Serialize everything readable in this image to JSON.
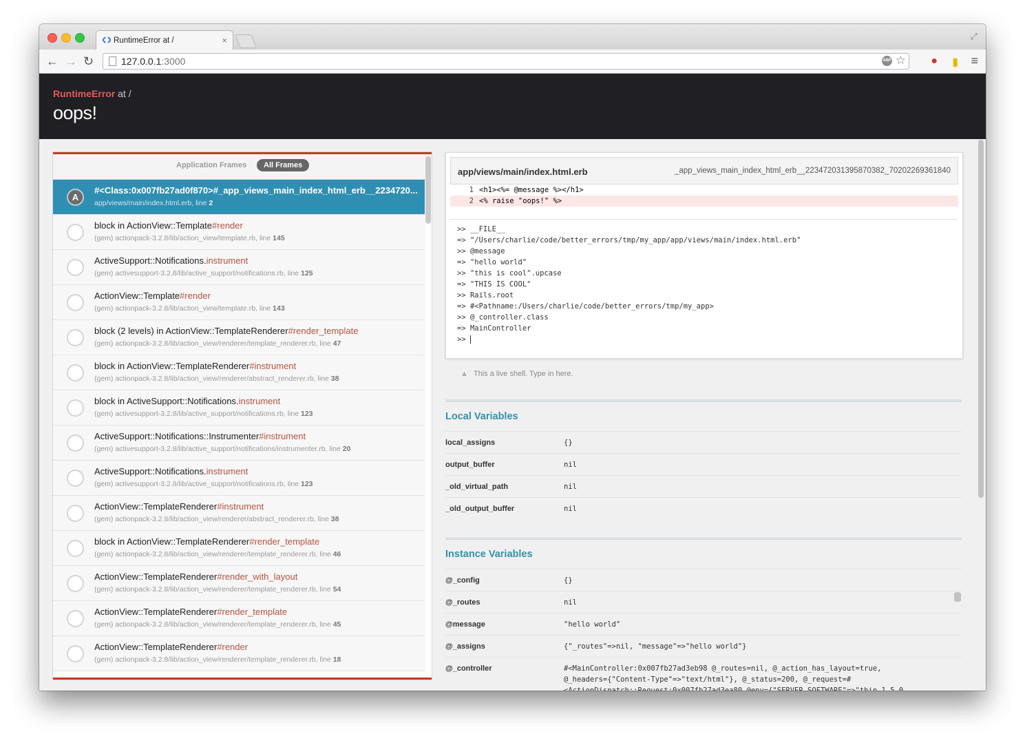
{
  "browser": {
    "tab_title": "RuntimeError at /",
    "tab_close": "×",
    "url_host": "127.0.0.1",
    "url_port": ":3000",
    "abp_label": "ABP"
  },
  "error": {
    "class": "RuntimeError",
    "at": " at /",
    "message": "oops!"
  },
  "frames_tabs": {
    "application": "Application Frames",
    "all": "All Frames"
  },
  "frames": [
    {
      "circle": "A",
      "name": "#<Class:0x007fb27ad0f870>#_app_views_main_index_html_erb__2234720...",
      "method": "",
      "loc": "app/views/main/index.html.erb, line ",
      "line": "2",
      "selected": true
    },
    {
      "circle": "",
      "name": "block in ActionView::Template",
      "method": "#render",
      "loc": "(gem) actionpack-3.2.8/lib/action_view/template.rb, line ",
      "line": "145"
    },
    {
      "circle": "",
      "name": "ActiveSupport::Notifications.",
      "method": "instrument",
      "loc": "(gem) activesupport-3.2.8/lib/active_support/notifications.rb, line ",
      "line": "125"
    },
    {
      "circle": "",
      "name": "ActionView::Template",
      "method": "#render",
      "loc": "(gem) actionpack-3.2.8/lib/action_view/template.rb, line ",
      "line": "143"
    },
    {
      "circle": "",
      "name": "block (2 levels) in ActionView::TemplateRenderer",
      "method": "#render_template",
      "loc": "(gem) actionpack-3.2.8/lib/action_view/renderer/template_renderer.rb, line ",
      "line": "47"
    },
    {
      "circle": "",
      "name": "block in ActionView::TemplateRenderer",
      "method": "#instrument",
      "loc": "(gem) actionpack-3.2.8/lib/action_view/renderer/abstract_renderer.rb, line ",
      "line": "38"
    },
    {
      "circle": "",
      "name": "block in ActiveSupport::Notifications.",
      "method": "instrument",
      "loc": "(gem) activesupport-3.2.8/lib/active_support/notifications.rb, line ",
      "line": "123"
    },
    {
      "circle": "",
      "name": "ActiveSupport::Notifications::Instrumenter",
      "method": "#instrument",
      "loc": "(gem) activesupport-3.2.8/lib/active_support/notifications/instrumenter.rb, line ",
      "line": "20"
    },
    {
      "circle": "",
      "name": "ActiveSupport::Notifications.",
      "method": "instrument",
      "loc": "(gem) activesupport-3.2.8/lib/active_support/notifications.rb, line ",
      "line": "123"
    },
    {
      "circle": "",
      "name": "ActionView::TemplateRenderer",
      "method": "#instrument",
      "loc": "(gem) actionpack-3.2.8/lib/action_view/renderer/abstract_renderer.rb, line ",
      "line": "38"
    },
    {
      "circle": "",
      "name": "block in ActionView::TemplateRenderer",
      "method": "#render_template",
      "loc": "(gem) actionpack-3.2.8/lib/action_view/renderer/template_renderer.rb, line ",
      "line": "46"
    },
    {
      "circle": "",
      "name": "ActionView::TemplateRenderer",
      "method": "#render_with_layout",
      "loc": "(gem) actionpack-3.2.8/lib/action_view/renderer/template_renderer.rb, line ",
      "line": "54"
    },
    {
      "circle": "",
      "name": "ActionView::TemplateRenderer",
      "method": "#render_template",
      "loc": "(gem) actionpack-3.2.8/lib/action_view/renderer/template_renderer.rb, line ",
      "line": "45"
    },
    {
      "circle": "",
      "name": "ActionView::TemplateRenderer",
      "method": "#render",
      "loc": "(gem) actionpack-3.2.8/lib/action_view/renderer/template_renderer.rb, line ",
      "line": "18"
    }
  ],
  "code": {
    "path": "app/views/main/index.html.erb",
    "method": "_app_views_main_index_html_erb__2234720313958703​82_70202269361840",
    "lines": [
      {
        "num": "1",
        "text": "<h1><%= @message %></h1>",
        "highlight": false
      },
      {
        "num": "2",
        "text": "<% raise \"oops!\" %>",
        "highlight": true
      }
    ]
  },
  "repl": [
    ">> __FILE__",
    "=> \"/Users/charlie/code/better_errors/tmp/my_app/app/views/main/index.html.erb\"",
    ">> @message",
    "=> \"hello world\"",
    ">> \"this is cool\".upcase",
    "=> \"THIS IS COOL\"",
    ">> Rails.root",
    "=> #<Pathname:/Users/charlie/code/better_errors/tmp/my_app>",
    ">> @_controller.class",
    "=> MainController",
    ">> "
  ],
  "repl_hint": "This a live shell. Type in here.",
  "local_variables": {
    "title": "Local Variables",
    "rows": [
      {
        "name": "local_assigns",
        "value": "{}"
      },
      {
        "name": "output_buffer",
        "value": "nil"
      },
      {
        "name": "_old_virtual_path",
        "value": "nil"
      },
      {
        "name": "_old_output_buffer",
        "value": "nil"
      }
    ]
  },
  "instance_variables": {
    "title": "Instance Variables",
    "rows": [
      {
        "name": "@_config",
        "value": "{}"
      },
      {
        "name": "@_routes",
        "value": "nil"
      },
      {
        "name": "@message",
        "value": "\"hello world\""
      },
      {
        "name": "@_assigns",
        "value": "{\"_routes\"=>nil, \"message\"=>\"hello world\"}"
      },
      {
        "name": "@_controller",
        "value": "#<MainController:0x007fb27ad3eb98 @_routes=nil, @_action_has_layout=true,\n@_headers={\"Content-Type\"=>\"text/html\"}, @_status=200, @_request=#\n<ActionDispatch::Request:0x007fb27ad3ea80 @env={\"SERVER_SOFTWARE\"=>\"thin 1.5.0"
      }
    ]
  }
}
